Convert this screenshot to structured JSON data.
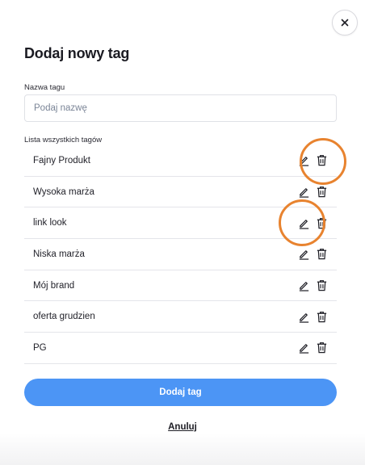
{
  "modal": {
    "title": "Dodaj nowy tag",
    "close_icon": "close-icon"
  },
  "name_field": {
    "label": "Nazwa tagu",
    "value": "",
    "placeholder": "Podaj nazwę"
  },
  "tags": {
    "label": "Lista wszystkich tagów",
    "items": [
      {
        "label": "Fajny Produkt"
      },
      {
        "label": "Wysoka marża"
      },
      {
        "label": "link look"
      },
      {
        "label": "Niska marża"
      },
      {
        "label": "Mój brand"
      },
      {
        "label": "oferta grudzien"
      },
      {
        "label": "PG"
      }
    ],
    "row_icons": [
      "edit-icon",
      "trash-icon"
    ]
  },
  "actions": {
    "add_label": "Dodaj tag",
    "cancel_label": "Anuluj"
  },
  "colors": {
    "primary": "#4c95f5",
    "highlight": "#e8832f",
    "placeholder": "#7b8597"
  }
}
